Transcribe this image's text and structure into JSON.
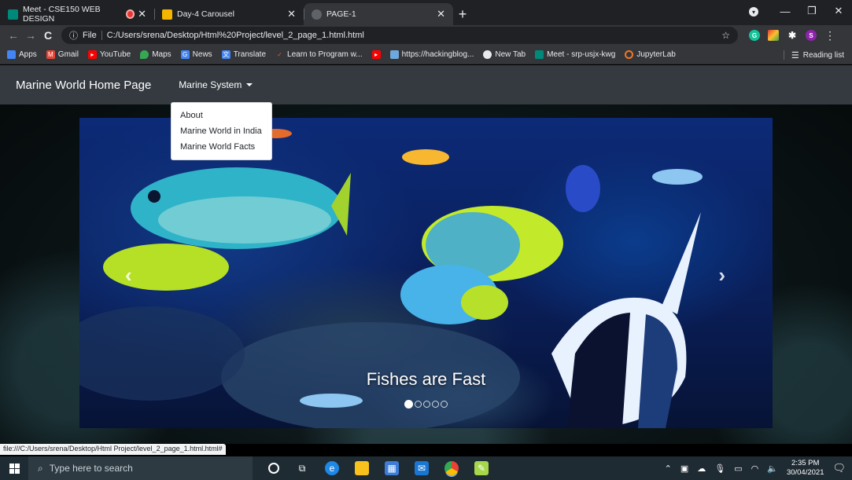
{
  "browser": {
    "tabs": [
      {
        "title": "Meet - CSE150 WEB DESIGN",
        "icon": "meet-icon"
      },
      {
        "title": "Day-4 Carousel",
        "icon": "slides-icon"
      },
      {
        "title": "PAGE-1",
        "icon": "globe-icon"
      }
    ],
    "new_tab": "+",
    "address": {
      "scheme_label": "File",
      "url": "C:/Users/srena/Desktop/Html%20Project/level_2_page_1.html.html"
    },
    "extensions": [
      "G",
      "S"
    ],
    "bookmarks": [
      {
        "label": "Apps",
        "color": "#4285f4"
      },
      {
        "label": "Gmail",
        "color": "#ea4335"
      },
      {
        "label": "YouTube",
        "color": "#ff0000"
      },
      {
        "label": "Maps",
        "color": "#34a853"
      },
      {
        "label": "News",
        "color": "#4285f4"
      },
      {
        "label": "Translate",
        "color": "#4285f4"
      },
      {
        "label": "Learn to Program w...",
        "color": "#f4511e"
      },
      {
        "label": "",
        "color": "#ff0000"
      },
      {
        "label": "https://hackingblog...",
        "color": "#6fa8dc"
      },
      {
        "label": "New Tab",
        "color": "#e8eaed"
      },
      {
        "label": "Meet - srp-usjx-kwg",
        "color": "#00897b"
      },
      {
        "label": "JupyterLab",
        "color": "#f37626"
      }
    ],
    "reading_list": "Reading list",
    "status_url": "file:///C:/Users/srena/Desktop/Html Project/level_2_page_1.html.html#"
  },
  "page": {
    "brand": "Marine World Home Page",
    "dropdown": {
      "label": "Marine System",
      "items": [
        "About",
        "Marine World in India",
        "Marine World Facts"
      ]
    },
    "carousel": {
      "caption": "Fishes are Fast",
      "prev": "‹",
      "next": "›",
      "slide_count": 5,
      "active_index": 0
    }
  },
  "taskbar": {
    "search_placeholder": "Type here to search",
    "time": "2:35 PM",
    "date": "30/04/2021"
  }
}
